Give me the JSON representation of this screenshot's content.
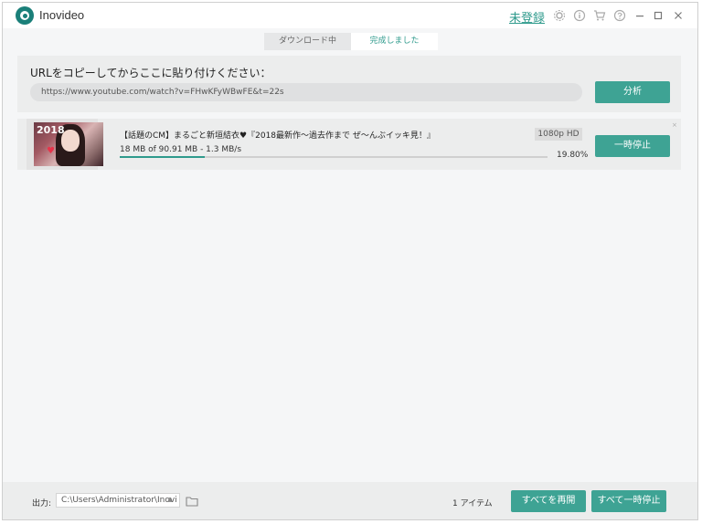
{
  "app": {
    "title": "Inovideo",
    "register_label": "未登録",
    "accent_color": "#3ea394"
  },
  "titlebar_icons": [
    "gear-icon",
    "info-icon",
    "cart-icon",
    "help-icon",
    "minimize-icon",
    "maximize-icon",
    "close-icon"
  ],
  "tabs": {
    "downloading": "ダウンロード中",
    "completed": "完成しました"
  },
  "url_panel": {
    "heading": "URLをコピーしてからここに貼り付けください：",
    "url_value": "https://www.youtube.com/watch?v=FHwKFyWBwFE&t=22s",
    "analyze_label": "分析"
  },
  "download": {
    "thumbnail_text": "2018",
    "title": "【話題のCM】まるごと新垣結衣♥『2018最新作～過去作まで ぜ～んぶイッキ見！』",
    "quality": "1080p HD",
    "progress_text": "18 MB of 90.91 MB - 1.3 MB/s",
    "percent_label": "19.80%",
    "progress": 0.198,
    "pause_label": "一時停止",
    "close_glyph": "×"
  },
  "footer": {
    "output_label": "出力:",
    "output_path": "C:\\Users\\Administrator\\Inovi",
    "item_count": "1 アイテム",
    "resume_all_label": "すべてを再開",
    "pause_all_label": "すべて一時停止"
  }
}
